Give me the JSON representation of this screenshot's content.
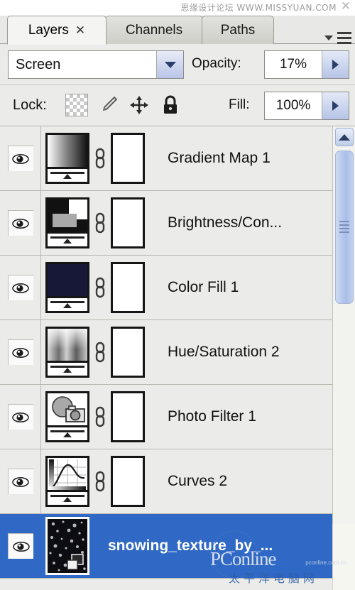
{
  "watermarks": {
    "top_text": "思缘设计论坛 WWW.MISSYUAN.COM",
    "top_close_glyph": "✕",
    "bottom_brand": "PConline",
    "bottom_cn": "太平洋电脑网",
    "bottom_sub": "pconline.com.cn"
  },
  "tabs": [
    {
      "label": "Layers",
      "active": true,
      "close_glyph": "✕"
    },
    {
      "label": "Channels",
      "active": false
    },
    {
      "label": "Paths",
      "active": false
    }
  ],
  "panel_menu": {
    "name": "panel-menu-button"
  },
  "blend": {
    "mode_value": "Screen",
    "opacity_label": "Opacity:",
    "opacity_value": "17%"
  },
  "lock": {
    "label": "Lock:",
    "icons": [
      {
        "name": "lock-transparent-pixels-icon",
        "title": "Lock transparent pixels"
      },
      {
        "name": "lock-image-pixels-icon",
        "title": "Lock image pixels"
      },
      {
        "name": "lock-position-icon",
        "title": "Lock position"
      },
      {
        "name": "lock-all-icon",
        "title": "Lock all"
      }
    ],
    "fill_label": "Fill:",
    "fill_value": "100%"
  },
  "layers": [
    {
      "name": "Gradient Map 1",
      "visible": true,
      "selected": false,
      "type": "adjustment",
      "thumb": "gradient-map",
      "has_mask": true,
      "linked": true
    },
    {
      "name": "Brightness/Con...",
      "visible": true,
      "selected": false,
      "type": "adjustment",
      "thumb": "brightness-contrast",
      "has_mask": true,
      "linked": true
    },
    {
      "name": "Color Fill 1",
      "visible": true,
      "selected": false,
      "type": "fill",
      "thumb": "solid-color",
      "thumb_color": "#171737",
      "has_mask": true,
      "linked": true
    },
    {
      "name": "Hue/Saturation 2",
      "visible": true,
      "selected": false,
      "type": "adjustment",
      "thumb": "hue-saturation",
      "has_mask": true,
      "linked": true
    },
    {
      "name": "Photo Filter 1",
      "visible": true,
      "selected": false,
      "type": "adjustment",
      "thumb": "photo-filter",
      "has_mask": true,
      "linked": true
    },
    {
      "name": "Curves 2",
      "visible": true,
      "selected": false,
      "type": "adjustment",
      "thumb": "curves",
      "has_mask": true,
      "linked": true
    },
    {
      "name": "snowing_texture_by_...",
      "visible": true,
      "selected": true,
      "type": "smart-object",
      "thumb": "snow-texture",
      "has_mask": false,
      "linked": false
    }
  ],
  "scrollbar": {
    "up_arrow": "scroll-up-arrow",
    "thumb": "scroll-thumb"
  },
  "colors": {
    "selection_blue": "#3069c5",
    "panel_bg": "#ebebe9",
    "tab_active_bg": "#f4f4f2",
    "accent_arrow": "#2b3f6b"
  }
}
